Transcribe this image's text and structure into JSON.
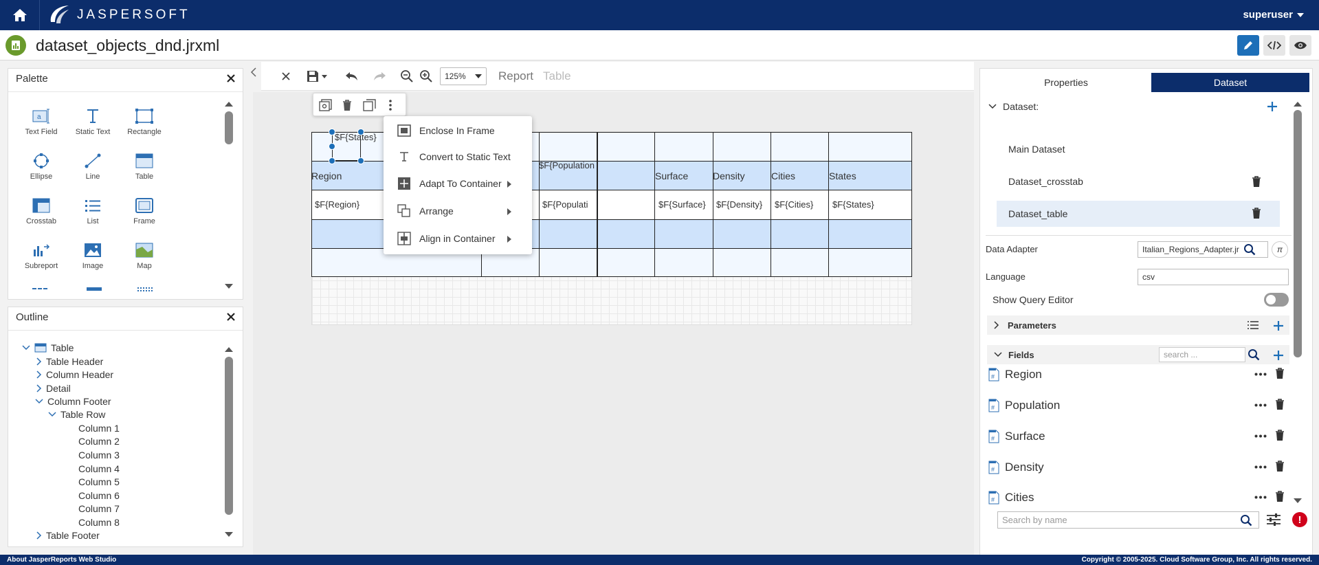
{
  "header": {
    "app_name": "JASPERSOFT",
    "user": "superuser"
  },
  "titlebar": {
    "file_name": "dataset_objects_dnd.jrxml"
  },
  "palette": {
    "title": "Palette",
    "items": [
      "Text Field",
      "Static Text",
      "Rectangle",
      "Ellipse",
      "Line",
      "Table",
      "Crosstab",
      "List",
      "Frame",
      "Subreport",
      "Image",
      "Map"
    ]
  },
  "outline": {
    "title": "Outline",
    "root": "Table",
    "nodes": [
      "Table Header",
      "Column Header",
      "Detail",
      "Column Footer"
    ],
    "row": "Table Row",
    "columns": [
      "Column 1",
      "Column 2",
      "Column 3",
      "Column 4",
      "Column 5",
      "Column 6",
      "Column 7",
      "Column 8"
    ],
    "last": "Table Footer"
  },
  "toolbar": {
    "zoom": "125%",
    "crumb_report": "Report",
    "crumb_table": "Table"
  },
  "table": {
    "top_cell": "$F{States}",
    "header": [
      "Region",
      "$F{Population",
      "Surface",
      "Density",
      "Cities",
      "States"
    ],
    "detail": [
      "$F{Region}",
      "$F{Populati",
      "$F{Surface}",
      "$F{Density}",
      "$F{Cities}",
      "$F{States}"
    ]
  },
  "context_menu": {
    "items": [
      "Enclose In Frame",
      "Convert to Static Text",
      "Adapt To Container",
      "Arrange",
      "Align in Container"
    ]
  },
  "right_panel": {
    "tabs": [
      "Properties",
      "Dataset"
    ],
    "dataset_label": "Dataset:",
    "datasets": [
      "Main Dataset",
      "Dataset_crosstab",
      "Dataset_table"
    ],
    "data_adapter_label": "Data Adapter",
    "data_adapter_value": "Italian_Regions_Adapter.jr",
    "language_label": "Language",
    "language_value": "csv",
    "show_query_label": "Show Query Editor",
    "parameters_label": "Parameters",
    "fields_label": "Fields",
    "fields_search_placeholder": "search ...",
    "fields": [
      "Region",
      "Population",
      "Surface",
      "Density",
      "Cities"
    ],
    "search_placeholder": "Search by name"
  },
  "footer": {
    "left": "About JasperReports Web Studio",
    "right": "Copyright © 2005-2025. Cloud Software Group, Inc. All rights reserved."
  },
  "colors": {
    "brand": "#0c2d6b",
    "accent": "#1d6fb8",
    "band": "#cfe3fb",
    "error": "#d0021b"
  }
}
